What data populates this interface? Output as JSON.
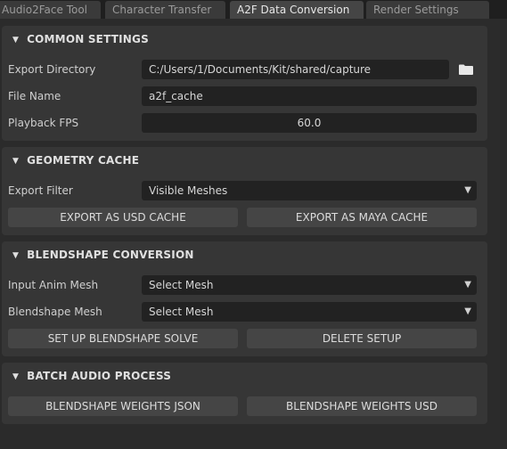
{
  "tabs": [
    {
      "label": "Audio2Face Tool",
      "active": false
    },
    {
      "label": "Character Transfer",
      "active": false
    },
    {
      "label": "A2F Data Conversion",
      "active": true
    },
    {
      "label": "Render Settings",
      "active": false
    }
  ],
  "common": {
    "title": "COMMON SETTINGS",
    "export_dir_label": "Export Directory",
    "export_dir_value": "C:/Users/1/Documents/Kit/shared/capture",
    "folder_icon": "folder-icon",
    "file_name_label": "File Name",
    "file_name_value": "a2f_cache",
    "fps_label": "Playback FPS",
    "fps_value": "60.0"
  },
  "geometry": {
    "title": "GEOMETRY CACHE",
    "filter_label": "Export Filter",
    "filter_value": "Visible Meshes",
    "usd_button": "EXPORT AS USD CACHE",
    "maya_button": "EXPORT AS MAYA CACHE"
  },
  "blendshape": {
    "title": "BLENDSHAPE CONVERSION",
    "input_label": "Input Anim Mesh",
    "input_value": "Select Mesh",
    "bs_label": "Blendshape Mesh",
    "bs_value": "Select Mesh",
    "setup_button": "SET UP BLENDSHAPE SOLVE",
    "delete_button": "DELETE SETUP"
  },
  "batch": {
    "title": "BATCH AUDIO PROCESS",
    "json_button": "BLENDSHAPE WEIGHTS JSON",
    "usd_button": "BLENDSHAPE WEIGHTS USD"
  },
  "colors": {
    "background": "#2b2b2b",
    "panel": "#363636",
    "field": "#222222",
    "button": "#454545",
    "active_tab": "#454545"
  }
}
